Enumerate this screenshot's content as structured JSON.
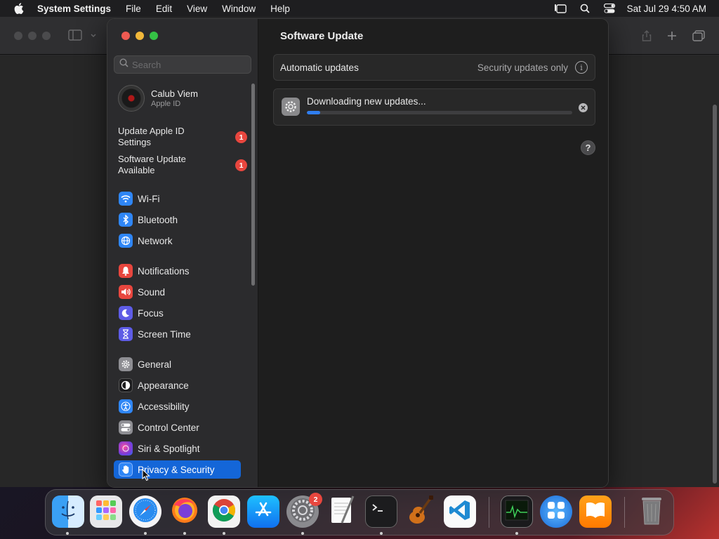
{
  "menubar": {
    "apple_icon": "apple-logo-icon",
    "app_name": "System Settings",
    "menus": [
      "File",
      "Edit",
      "View",
      "Window",
      "Help"
    ],
    "status_icons": [
      "stage-manager-icon",
      "spotlight-search-icon",
      "control-center-icon"
    ],
    "clock": "Sat Jul 29  4:50 AM"
  },
  "sidebar": {
    "search": {
      "placeholder": "Search"
    },
    "profile": {
      "name": "Calub Viem",
      "subtitle": "Apple ID"
    },
    "notices": [
      {
        "label_line1": "Update Apple ID",
        "label_line2": "Settings",
        "badge": "1"
      },
      {
        "label_line1": "Software Update",
        "label_line2": "Available",
        "badge": "1"
      }
    ],
    "items": [
      {
        "label": "Wi-Fi",
        "icon": "wifi-icon",
        "color": "#2f86f6"
      },
      {
        "label": "Bluetooth",
        "icon": "bluetooth-icon",
        "color": "#2f86f6"
      },
      {
        "label": "Network",
        "icon": "globe-icon",
        "color": "#2f86f6"
      },
      {
        "label": "Notifications",
        "icon": "bell-icon",
        "color": "#e8463e"
      },
      {
        "label": "Sound",
        "icon": "speaker-icon",
        "color": "#e8463e"
      },
      {
        "label": "Focus",
        "icon": "moon-icon",
        "color": "#5e5ce6"
      },
      {
        "label": "Screen Time",
        "icon": "hourglass-icon",
        "color": "#5e5ce6"
      },
      {
        "label": "General",
        "icon": "gear-icon",
        "color": "#8e8e93"
      },
      {
        "label": "Appearance",
        "icon": "appearance-icon",
        "color": "#1c1c1e"
      },
      {
        "label": "Accessibility",
        "icon": "accessibility-icon",
        "color": "#2f86f6"
      },
      {
        "label": "Control Center",
        "icon": "control-center-icon",
        "color": "#8e8e93"
      },
      {
        "label": "Siri & Spotlight",
        "icon": "siri-icon",
        "color": "#7a3cd8"
      },
      {
        "label": "Privacy & Security",
        "icon": "hand-icon",
        "color": "#2f86f6"
      }
    ]
  },
  "main": {
    "title": "Software Update",
    "automatic_updates": {
      "label": "Automatic updates",
      "value": "Security updates only"
    },
    "download": {
      "label": "Downloading new updates...",
      "progress": 0.05
    },
    "help_label": "?"
  },
  "dock": {
    "apps": [
      {
        "name": "Finder",
        "icon": "finder-icon",
        "running": true
      },
      {
        "name": "Launchpad",
        "icon": "launchpad-icon",
        "running": false
      },
      {
        "name": "Safari",
        "icon": "safari-icon",
        "running": true
      },
      {
        "name": "Firefox",
        "icon": "firefox-icon",
        "running": true
      },
      {
        "name": "Chrome",
        "icon": "chrome-icon",
        "running": true
      },
      {
        "name": "App Store",
        "icon": "app-store-icon",
        "running": false
      },
      {
        "name": "System Settings",
        "icon": "system-settings-icon",
        "running": true,
        "badge": "2"
      },
      {
        "name": "TextEdit",
        "icon": "textedit-icon",
        "running": false
      },
      {
        "name": "Terminal",
        "icon": "terminal-icon",
        "running": true
      },
      {
        "name": "GarageBand",
        "icon": "garageband-icon",
        "running": false
      },
      {
        "name": "Visual Studio Code",
        "icon": "vscode-icon",
        "running": false
      },
      {
        "name": "Activity Monitor",
        "icon": "activity-monitor-icon",
        "running": true
      },
      {
        "name": "Mission Control",
        "icon": "mission-control-icon",
        "running": false
      },
      {
        "name": "Books",
        "icon": "books-icon",
        "running": false
      },
      {
        "name": "Trash",
        "icon": "trash-icon",
        "running": false
      }
    ]
  }
}
